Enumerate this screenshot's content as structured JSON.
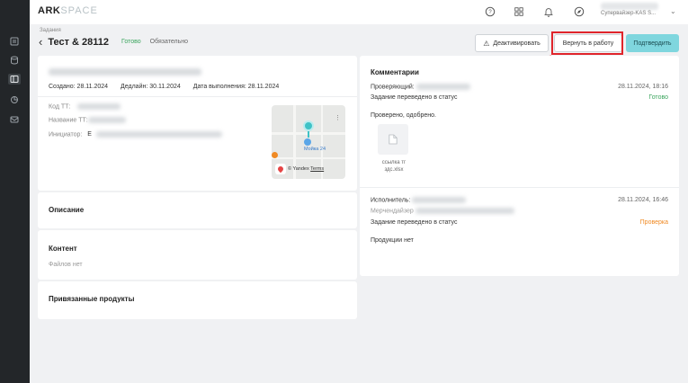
{
  "app": {
    "logo_primary": "ARK",
    "logo_secondary": "SPACE"
  },
  "user": {
    "role": "Супервайзер-KAS S..."
  },
  "breadcrumb": "Задания",
  "header": {
    "title": "Тест & 28112",
    "status": "Готово",
    "required": "Обязательно"
  },
  "buttons": {
    "deactivate": "Деактивировать",
    "return": "Вернуть в работу",
    "confirm": "Подтвердить"
  },
  "task": {
    "created": "Создано: 28.11.2024",
    "deadline": "Дедлайн: 30.11.2024",
    "completed": "Дата выполнения: 28.11.2024",
    "labels": {
      "code": "Код ТТ:",
      "name": "Название ТТ:",
      "initiator": "Инициатор:",
      "initiator_value": "E"
    }
  },
  "map": {
    "place_label": "Мойка 24",
    "credit": "© Yandex",
    "terms": "Terms"
  },
  "sections": {
    "description": "Описание",
    "content": "Контент",
    "files_none": "Файлов нет",
    "products": "Привязанные продукты"
  },
  "comments": {
    "title": "Комментарии",
    "entry1": {
      "author_label": "Проверяющий:",
      "datetime": "28.11.2024, 18:16",
      "status_text": "Задание переведено в статус",
      "status_value": "Готово",
      "text": "Проверено, одобрено.",
      "file_name": "ссылка тг здс.xlsx"
    },
    "entry2": {
      "author_label": "Исполнитель:",
      "datetime": "28.11.2024, 16:46",
      "role_label": "Мерчендайзер",
      "status_text": "Задание переведено в статус",
      "status_value": "Проверка",
      "products_none": "Продукции нет"
    }
  },
  "colors": {
    "accent": "#7fd6de",
    "ready": "#3aa55d",
    "check": "#f08a24",
    "highlight": "#e0252b",
    "sidebar": "#232629"
  }
}
